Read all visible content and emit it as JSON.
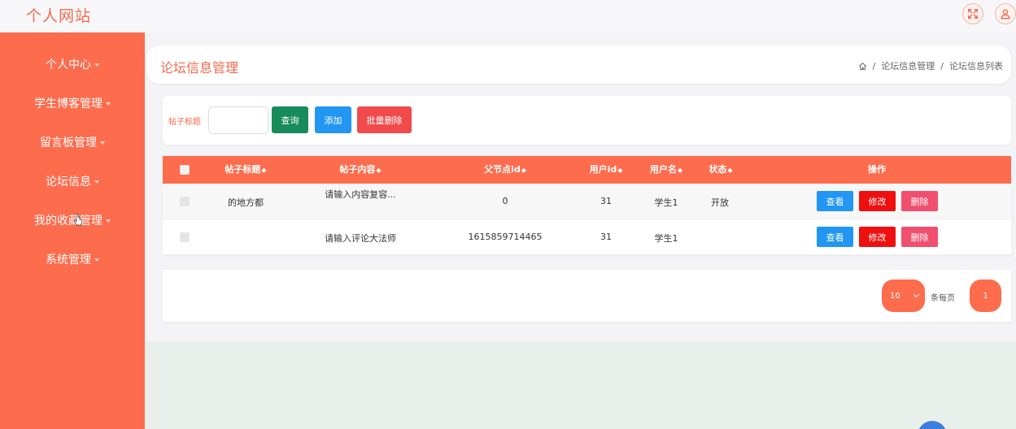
{
  "app": {
    "brand": "个人网站"
  },
  "header": {
    "icons": [
      "fullscreen-icon",
      "user-icon"
    ]
  },
  "sidebar": {
    "items": [
      {
        "label": "个人中心"
      },
      {
        "label": "学生博客管理"
      },
      {
        "label": "留言板管理"
      },
      {
        "label": "论坛信息"
      },
      {
        "label": "我的收藏管理"
      },
      {
        "label": "系统管理"
      }
    ]
  },
  "page": {
    "title": "论坛信息管理",
    "breadcrumb": [
      "论坛信息管理",
      "论坛信息列表"
    ],
    "breadcrumb_sep": "/"
  },
  "search": {
    "label": "帖子标题",
    "value": "",
    "query_label": "查询",
    "add_label": "添加",
    "batch_delete_label": "批量删除"
  },
  "table": {
    "sort_glyph": "◆",
    "columns": [
      "帖子标题",
      "帖子内容",
      "父节点id",
      "用户id",
      "用户名",
      "状态",
      "操作"
    ],
    "rows": [
      {
        "title": "的地方都",
        "content": "请输入内容复容...",
        "parent_id": "0",
        "user_id": "31",
        "username": "学生1",
        "status": "开放"
      },
      {
        "title": "",
        "content": "请输入评论大法师",
        "parent_id": "1615859714465",
        "user_id": "31",
        "username": "学生1",
        "status": ""
      }
    ],
    "actions": {
      "view": "查看",
      "edit": "修改",
      "delete": "删除"
    }
  },
  "pagination": {
    "page_size": "10",
    "per_page_label": "条每页",
    "current_page": "1"
  },
  "colors": {
    "accent": "#fd6c4d",
    "query": "#178b5a",
    "add": "#2196f3",
    "batch_delete": "#f04a4a",
    "edit": "#ef0f0f",
    "delete": "#f0506e"
  }
}
